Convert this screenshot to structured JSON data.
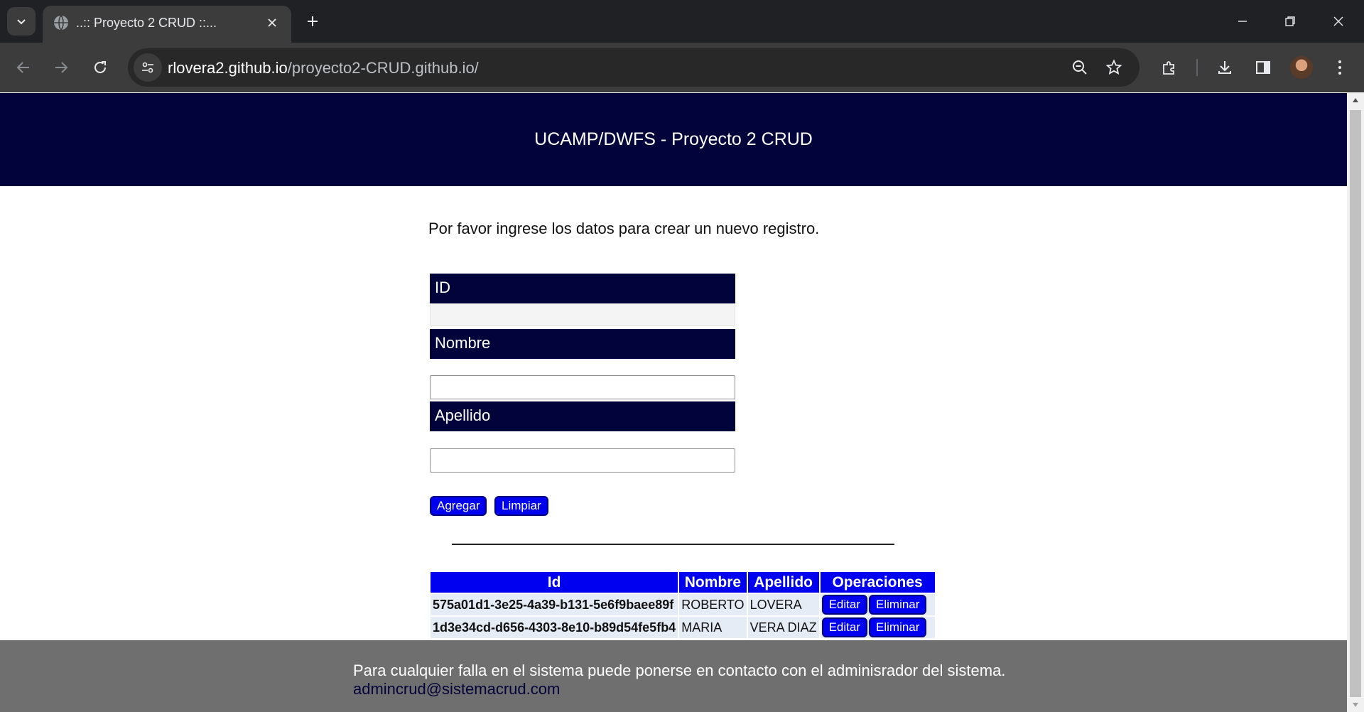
{
  "browser": {
    "tab_title": "..:: Proyecto 2 CRUD ::...",
    "url_host": "rlovera2.github.io",
    "url_path": "/proyecto2-CRUD.github.io/"
  },
  "page": {
    "header_title": "UCAMP/DWFS - Proyecto 2 CRUD",
    "intro_text": "Por favor ingrese los datos para crear un nuevo registro.",
    "form": {
      "id_label": "ID",
      "id_value": "",
      "nombre_label": "Nombre",
      "nombre_value": "",
      "apellido_label": "Apellido",
      "apellido_value": "",
      "agregar_label": "Agregar",
      "limpiar_label": "Limpiar"
    },
    "table": {
      "headers": [
        "Id",
        "Nombre",
        "Apellido",
        "Operaciones"
      ],
      "rows": [
        {
          "id": "575a01d1-3e25-4a39-b131-5e6f9baee89f",
          "nombre": "ROBERTO",
          "apellido": "LOVERA",
          "edit": "Editar",
          "delete": "Eliminar"
        },
        {
          "id": "1d3e34cd-d656-4303-8e10-b89d54fe5fb4",
          "nombre": "MARIA",
          "apellido": "VERA DIAZ",
          "edit": "Editar",
          "delete": "Eliminar"
        }
      ]
    },
    "footer": {
      "text": "Para cualquier falla en el sistema puede ponerse en contacto con el adminisrador del sistema.",
      "email": "admincrud@sistemacrud.com"
    }
  },
  "colors": {
    "header_bg": "#03033b",
    "button_bg": "#0000f0",
    "footer_bg": "#6f6f6f",
    "table_cell_bg": "#e6ecf6"
  }
}
